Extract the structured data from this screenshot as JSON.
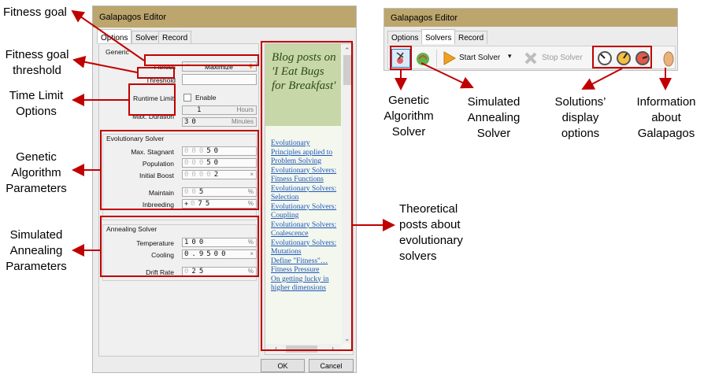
{
  "annotations": {
    "fitness_goal": "Fitness goal",
    "fitness_goal_threshold": [
      "Fitness goal",
      "threshold"
    ],
    "time_limit": [
      "Time Limit",
      "Options"
    ],
    "genetic_params": [
      "Genetic",
      "Algorithm",
      "Parameters"
    ],
    "annealing_params": [
      "Simulated",
      "Annealing",
      "Parameters"
    ],
    "theoretical_posts": [
      "Theoretical",
      "posts about",
      "evolutionary",
      "solvers"
    ],
    "ga_solver": [
      "Genetic",
      "Algorithm",
      "Solver"
    ],
    "sa_solver": [
      "Simulated",
      "Annealing",
      "Solver"
    ],
    "display_options": [
      "Solutions’",
      "display",
      "options"
    ],
    "info": [
      "Information",
      "about",
      "Galapagos"
    ]
  },
  "editor": {
    "title": "Galapagos Editor",
    "tabs": [
      "Options",
      "Solvers",
      "Record"
    ],
    "generic_label": "Generic",
    "fitness_label": "Fitness",
    "fitness_value": "Maximize",
    "threshold_label": "Threshold",
    "runtime_limit_label": "Runtime Limit",
    "enable_label": "Enable",
    "max_duration_label": "Max. Duration",
    "hours_value": "1",
    "hours_unit": "Hours",
    "minutes_value": "30",
    "minutes_unit": "Minutes",
    "evolutionary": {
      "title": "Evolutionary Solver",
      "max_stagnant_label": "Max. Stagnant",
      "max_stagnant_dim": "000",
      "max_stagnant_value": "50",
      "population_label": "Population",
      "population_dim": "000",
      "population_value": "50",
      "initial_boost_label": "Initial Boost",
      "initial_boost_dim": "0000",
      "initial_boost_value": "2",
      "initial_boost_unit": "×",
      "maintain_label": "Maintain",
      "maintain_dim": "00",
      "maintain_value": "5",
      "maintain_unit": "%",
      "inbreeding_label": "Inbreeding",
      "inbreeding_sign": "+",
      "inbreeding_dim": "0",
      "inbreeding_value": "75",
      "inbreeding_unit": "%"
    },
    "annealing": {
      "title": "Annealing Solver",
      "temperature_label": "Temperature",
      "temperature_value": "100",
      "temperature_unit": "%",
      "cooling_label": "Cooling",
      "cooling_value": "0.9500",
      "cooling_unit": "×",
      "drift_label": "Drift Rate",
      "drift_dim": "0",
      "drift_value": "25",
      "drift_unit": "%"
    },
    "blog": {
      "title": "Blog posts on 'I Eat Bugs for Breakfast'",
      "links": [
        "Evolutionary Principles applied to Problem Solving",
        "Evolutionary Solvers: Fitness Functions",
        "Evolutionary Solvers: Selection",
        "Evolutionary Solvers: Coupling",
        "Evolutionary Solvers: Coalescence",
        "Evolutionary Solvers: Mutations",
        "Define \"Fitness\"…",
        "Fitness Pressure",
        "On getting lucky in higher dimensions"
      ]
    },
    "ok_label": "OK",
    "cancel_label": "Cancel"
  },
  "solvers_window": {
    "title": "Galapagos Editor",
    "tabs": [
      "Options",
      "Solvers",
      "Record"
    ],
    "start_label": "Start Solver",
    "stop_label": "Stop Solver"
  },
  "colors": {
    "annotation_red": "#c00000",
    "titlebar": "#bca66d",
    "link": "#1b58b8",
    "blog_head": "#c7d7a7"
  }
}
